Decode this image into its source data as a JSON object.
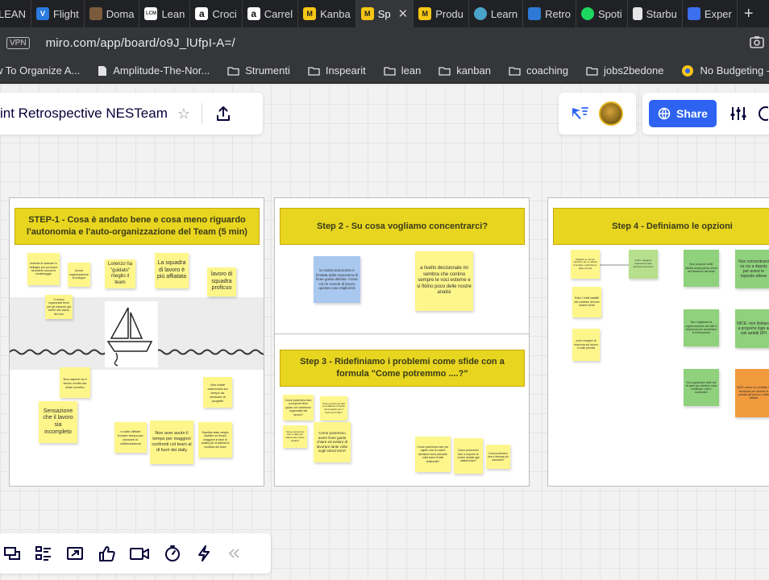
{
  "browser": {
    "tabs": [
      {
        "label": "LEAN",
        "fav_text": "",
        "fav_color": "#3a3a3a"
      },
      {
        "label": "Flight",
        "fav_text": "V",
        "fav_color": "#2a7bde"
      },
      {
        "label": "Doma",
        "fav_text": "",
        "fav_color": "#7a5c3d"
      },
      {
        "label": "Lean",
        "fav_text": "LCM",
        "fav_color": "#ffffff"
      },
      {
        "label": "Croci",
        "fav_text": "a",
        "fav_color": "#ffffff"
      },
      {
        "label": "Carrel",
        "fav_text": "a",
        "fav_color": "#ffffff"
      },
      {
        "label": "Kanba",
        "fav_text": "M",
        "fav_color": "#f6c614"
      },
      {
        "label": "Sp",
        "fav_text": "M",
        "fav_color": "#f6c614",
        "active": true
      },
      {
        "label": "Produ",
        "fav_text": "M",
        "fav_color": "#f6c614"
      },
      {
        "label": "Learn",
        "fav_text": "",
        "fav_color": "#4aa3c8"
      },
      {
        "label": "Retro",
        "fav_text": "",
        "fav_color": "#2d7ad6"
      },
      {
        "label": "Spoti",
        "fav_text": "",
        "fav_color": "#1ed760"
      },
      {
        "label": "Starbu",
        "fav_text": "",
        "fav_color": "#e6e6e6"
      },
      {
        "label": "Exper",
        "fav_text": "",
        "fav_color": "#3c6ff0"
      }
    ],
    "new_tab": "+",
    "close_glyph": "✕",
    "vpn": "VPN",
    "url": "miro.com/app/board/o9J_lUfpI-A=/",
    "bookmarks": [
      {
        "label": "w To Organize A...",
        "icon": "none"
      },
      {
        "label": "Amplitude-The-Nor...",
        "icon": "page"
      },
      {
        "label": "Strumenti",
        "icon": "folder"
      },
      {
        "label": "Inspearit",
        "icon": "folder"
      },
      {
        "label": "lean",
        "icon": "folder"
      },
      {
        "label": "kanban",
        "icon": "folder"
      },
      {
        "label": "coaching",
        "icon": "folder"
      },
      {
        "label": "jobs2bedone",
        "icon": "folder"
      },
      {
        "label": "No Budgeting - Per...",
        "icon": "badge"
      }
    ]
  },
  "miro": {
    "board_title": "int Retrospective NESTeam",
    "star": "☆",
    "share_label": "Share",
    "colors": {
      "share": "#2d63f0",
      "frame_header": "#e8d51f",
      "sticky_yellow": "#fef68b"
    }
  },
  "frames": {
    "f1": {
      "header": "STEP-1 - Cosa è andato bene e cosa meno riguardo l'autonomia e l'auto-organizzazione del Team (5 min)",
      "stickies": [
        {
          "text": "Insieme di sbarrare in dettaglio per poi avere strumenti comuni di monitoraggio"
        },
        {
          "text": "buona organizzazione di sviluppo"
        },
        {
          "text": "Lorenzo ha \"guidato\" meglio il team"
        },
        {
          "text": "La squadra di lavoro è più affiatata"
        },
        {
          "text": "lavoro di squadra proficuo"
        },
        {
          "text": "Ci siamo organizzati bene per gli imbarchi già scorsi che vanno del volo"
        },
        {
          "text": "Non sapere se il lavoro svolto sia stato corretto"
        },
        {
          "text": "Non totale autonomia sul tempo da dedicare al progetto"
        },
        {
          "text": "Sensazione che il lavoro sia incompleto"
        },
        {
          "text": "a volte difficile trovare tempo per lavorare in collaborazione"
        },
        {
          "text": "Non aver avuto il tempo per maggiori confronti col team al di fuori dei daily"
        },
        {
          "text": "Sarebbe stato meglio stabilire un tempo maggiore in fase di analisi per le attività di modifica del team"
        }
      ]
    },
    "f2": {
      "header": "Step 2 - Su cosa vogliamo concentrarci?",
      "stickies": [
        {
          "text": "la nostra autonomia è limitata dalla mancanza di linee guida definite. Forse con le recenti di lavoro questa cosa migliorerà"
        },
        {
          "text": "a livello decisionale mi sembra che contino sempre le voci esterne e si fidino poco delle nostre analisi"
        }
      ]
    },
    "f3": {
      "header": "Step 3 - Ridefiniamo i problemi come sfide con a formula \"Come potremmo ....?\"",
      "stickies": [
        {
          "text": "Come potremmo fare a proporre linee guida con chiarezza supportate dal lavoro?"
        },
        {
          "text": "Come potremmo fare a modificare il ritardo del progetto per il lavoro più utile?"
        },
        {
          "text": "Come potremmo fare a dare più fiducia alle nostre analisi?"
        },
        {
          "text": "Come potremmo avere linee guida chiare ed evitare di lavorare tante volte sugli stessi temi?"
        },
        {
          "text": "Come potremmo fare per capire che le nostre decisioni sono pensate sulla base di dati analizzati?"
        },
        {
          "text": "Come potremmo fare a esporre le nostre analisi agli stakeholder?"
        },
        {
          "text": "Come potremmo fare a lavorare più autonomi?"
        }
      ]
    },
    "f4": {
      "header": "Step 4 - Definiamo le opzioni",
      "stickies": [
        {
          "text": "Stabilire un tempo specifico per le attività di analisi e definizione delle priorità"
        },
        {
          "text": "Avere maggiore autonomia nelle decisioni sul lavoro"
        },
        {
          "text": "Entro i limiti stabiliti dal contesto devono essere chiari"
        },
        {
          "text": "poco margine di manovra sul lavoro e sulle priorità"
        },
        {
          "text": "Non proporre delle attività senza prima avere dei feedback dal team"
        },
        {
          "text": "Non concentrarsi su cio a deputy per avere le risposte attese"
        },
        {
          "text": "Non migliorare la organizzazione dei dati in sequenza per aumentare le informazioni"
        },
        {
          "text": "NICE: non limitarci a proporre logo ai soli ambiti DPI"
        },
        {
          "text": "Non organizzare delle call di sprint per chiedere come modificare i dati e condividere"
        },
        {
          "text": "NICE: avere un comitato di decisione per definire le priorità del lavoro e delle attività"
        }
      ]
    }
  }
}
